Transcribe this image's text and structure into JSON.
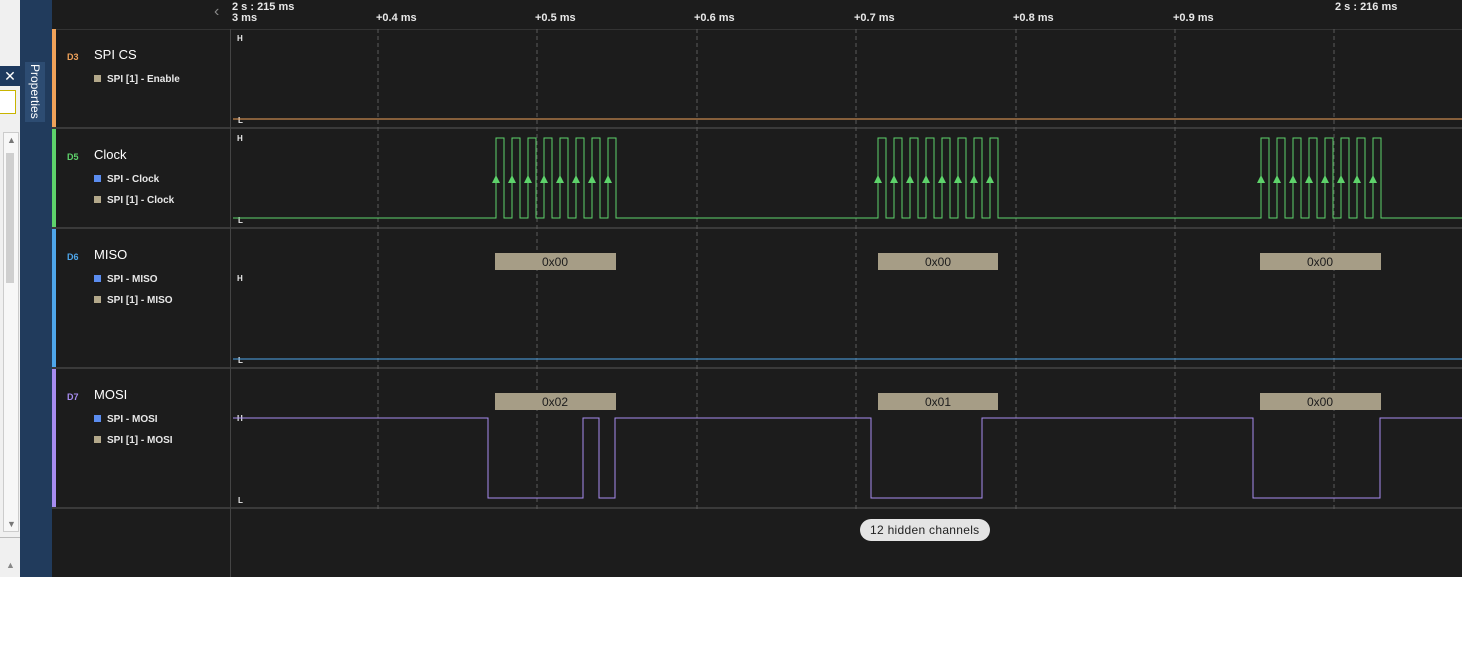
{
  "side_panel": {
    "tab_label": "Properties",
    "close_glyph": "✕",
    "scroll_up_glyph": "▲",
    "scroll_down_glyph": "▼"
  },
  "timeline": {
    "nav_glyph": "‹",
    "ref_left": "2 s : 215 ms",
    "left_partial_tick": "3 ms",
    "ref_right": "2 s : 216 ms",
    "ticks": [
      "+0.4 ms",
      "+0.5 ms",
      "+0.6 ms",
      "+0.7 ms",
      "+0.8 ms",
      "+0.9 ms"
    ]
  },
  "channels": [
    {
      "id": "D3",
      "name": "SPI CS",
      "color": "#f0a25a",
      "analyzers": [
        {
          "label": "SPI [1] - Enable",
          "color": "#b3a88a"
        }
      ]
    },
    {
      "id": "D5",
      "name": "Clock",
      "color": "#5ed36b",
      "analyzers": [
        {
          "label": "SPI - Clock",
          "color": "#5b8df0"
        },
        {
          "label": "SPI [1] - Clock",
          "color": "#b3a88a"
        }
      ]
    },
    {
      "id": "D6",
      "name": "MISO",
      "color": "#4ea6ea",
      "analyzers": [
        {
          "label": "SPI - MISO",
          "color": "#5b8df0"
        },
        {
          "label": "SPI [1] - MISO",
          "color": "#b3a88a"
        }
      ]
    },
    {
      "id": "D7",
      "name": "MOSI",
      "color": "#a78cf0",
      "analyzers": [
        {
          "label": "SPI - MOSI",
          "color": "#5b8df0"
        },
        {
          "label": "SPI [1] - MOSI",
          "color": "#b3a88a"
        }
      ]
    }
  ],
  "level_high": "H",
  "level_low": "L",
  "decoded": {
    "miso": [
      "0x00",
      "0x00",
      "0x00"
    ],
    "mosi": [
      "0x02",
      "0x01",
      "0x00"
    ]
  },
  "hidden_channels_label": "12 hidden channels"
}
